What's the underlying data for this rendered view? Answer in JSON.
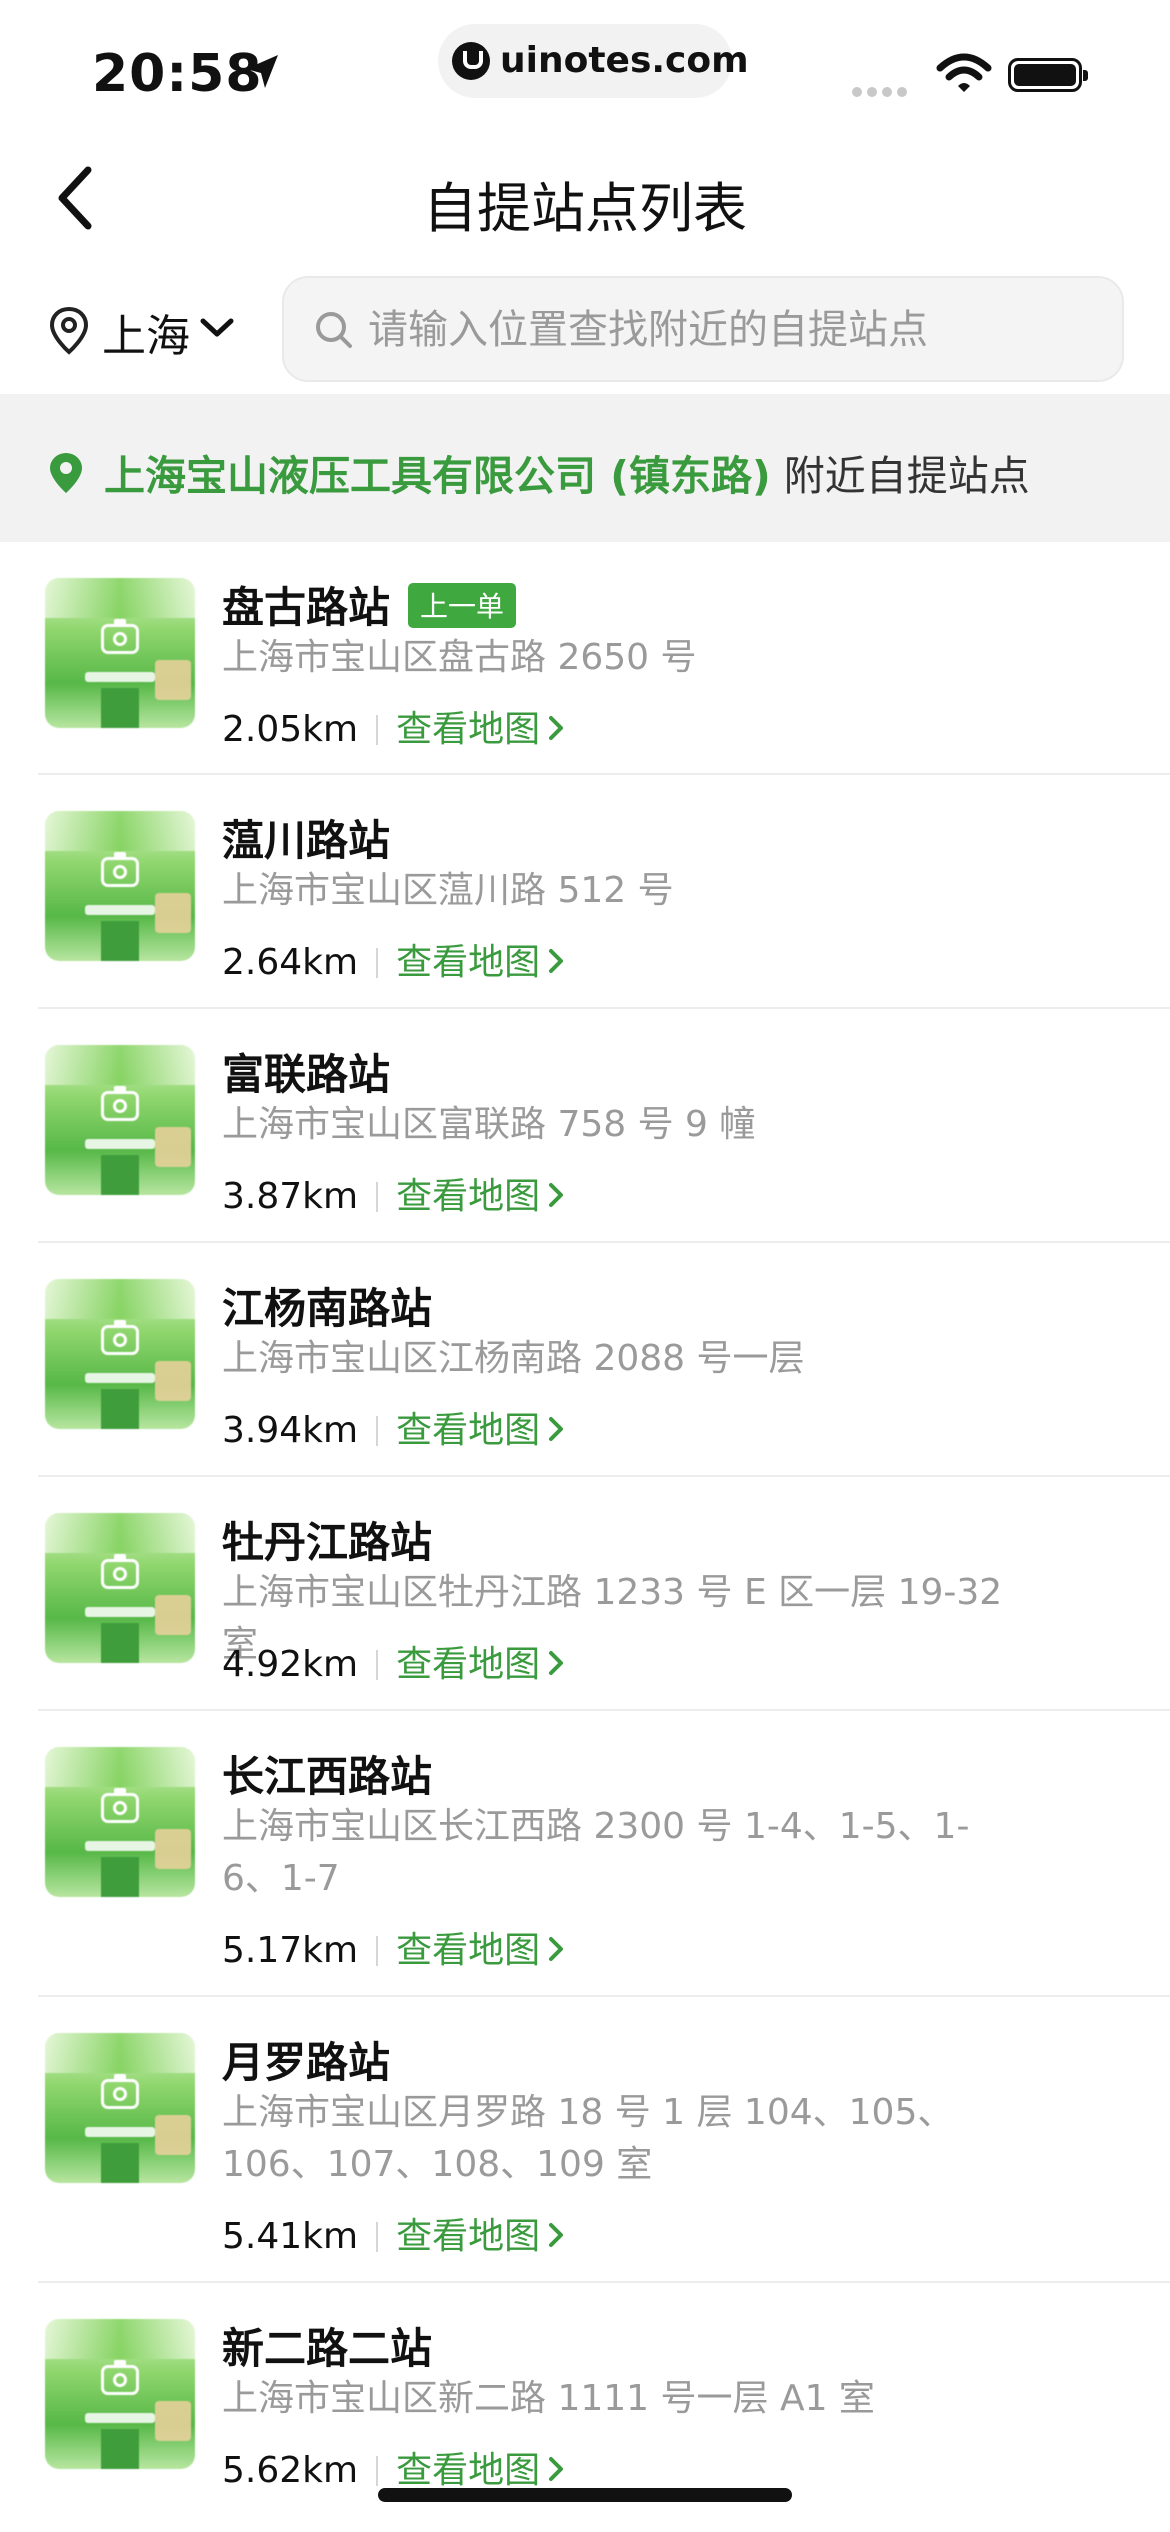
{
  "status_bar": {
    "time": "20:58",
    "url": "uinotes.com"
  },
  "nav": {
    "title": "自提站点列表"
  },
  "search": {
    "city": "上海",
    "placeholder": "请输入位置查找附近的自提站点"
  },
  "banner": {
    "location": "上海宝山液压工具有限公司 (镇东路)",
    "suffix": " 附近自提站点"
  },
  "colors": {
    "accent_green": "#3a9a3e",
    "badge_green": "#3fa83f"
  },
  "stations": [
    {
      "name": "盘古路站",
      "badge": "上一单",
      "address": "上海市宝山区盘古路 2650 号",
      "distance": "2.05km",
      "map_link": "查看地图"
    },
    {
      "name": "蕰川路站",
      "badge": "",
      "address": "上海市宝山区蕰川路 512 号",
      "distance": "2.64km",
      "map_link": "查看地图"
    },
    {
      "name": "富联路站",
      "badge": "",
      "address": "上海市宝山区富联路 758 号 9 幢",
      "distance": "3.87km",
      "map_link": "查看地图"
    },
    {
      "name": "江杨南路站",
      "badge": "",
      "address": "上海市宝山区江杨南路 2088 号一层",
      "distance": "3.94km",
      "map_link": "查看地图"
    },
    {
      "name": "牡丹江路站",
      "badge": "",
      "address": "上海市宝山区牡丹江路 1233 号 E 区一层 19-32 室",
      "distance": "4.92km",
      "map_link": "查看地图"
    },
    {
      "name": "长江西路站",
      "badge": "",
      "address": "上海市宝山区长江西路 2300 号 1-4、1-5、1-6、1-7",
      "distance": "5.17km",
      "map_link": "查看地图"
    },
    {
      "name": "月罗路站",
      "badge": "",
      "address": "上海市宝山区月罗路 18 号 1 层 104、105、106、107、108、109 室",
      "distance": "5.41km",
      "map_link": "查看地图"
    },
    {
      "name": "新二路二站",
      "badge": "",
      "address": "上海市宝山区新二路 1111 号一层 A1 室",
      "distance": "5.62km",
      "map_link": "查看地图"
    }
  ]
}
